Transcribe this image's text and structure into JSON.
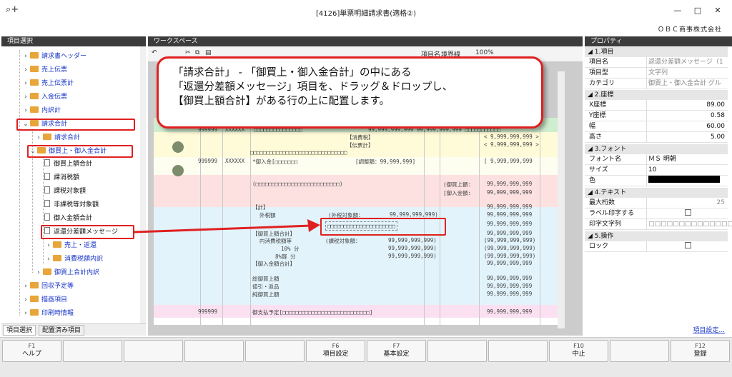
{
  "window": {
    "title": "[4126]単票明細請求書(適格②)",
    "company": "ＯＢＣ商事株式会社",
    "minimize": "—",
    "maximize": "□",
    "close": "✕"
  },
  "left_panel": {
    "header": "項目選択",
    "tree": [
      {
        "label": "請求書ヘッダー",
        "type": "folder",
        "expanded": false
      },
      {
        "label": "売上伝票",
        "type": "folder",
        "expanded": false
      },
      {
        "label": "売上伝票計",
        "type": "folder",
        "expanded": false
      },
      {
        "label": "入金伝票",
        "type": "folder",
        "expanded": false
      },
      {
        "label": "内訳計",
        "type": "folder",
        "expanded": false
      },
      {
        "label": "請求合計",
        "type": "folder",
        "expanded": true
      },
      {
        "label": "請求合計",
        "type": "folder",
        "expanded": false
      },
      {
        "label": "御買上・御入金合計",
        "type": "folder",
        "expanded": true
      },
      {
        "label": "御買上額合計",
        "type": "doc"
      },
      {
        "label": "課消税額",
        "type": "doc"
      },
      {
        "label": "課税対象額",
        "type": "doc"
      },
      {
        "label": "非課税等対象額",
        "type": "doc"
      },
      {
        "label": "御入金額合計",
        "type": "doc"
      },
      {
        "label": "返還分差額メッセージ",
        "type": "doc"
      },
      {
        "label": "売上・返還",
        "type": "folder",
        "expanded": false
      },
      {
        "label": "消費税額内訳",
        "type": "folder",
        "expanded": false
      },
      {
        "label": "御買上合計内訳",
        "type": "folder",
        "expanded": false
      },
      {
        "label": "回収予定等",
        "type": "folder",
        "expanded": false
      },
      {
        "label": "描画項目",
        "type": "folder",
        "expanded": false
      },
      {
        "label": "印刷時情報",
        "type": "folder",
        "expanded": false
      }
    ],
    "tabs": [
      "項目選択",
      "配置済み項目"
    ]
  },
  "workspace": {
    "header": "ワークスペース",
    "toolbar_labels": [
      "項目名",
      "境界線",
      "100%"
    ],
    "doc_texts": {
      "r1c1": "999999",
      "r1c2": "XXXXXX",
      "r1c3": "□□□□□□□□□□□□□□□",
      "r1c4": "99,999,999,999  99,999,999,999 □□□□□□□□□□□",
      "r2a": "【消費税】",
      "r2b": "< 9,999,999,999 >",
      "r3a": "【伝票計】",
      "r3b": "< 9,999,999,999 >",
      "r4": "□□□□□□□□□□□□□□□□□□□□□□□□□□□□□□",
      "r5a": "999999",
      "r5b": "XXXXXX",
      "r5c": "*御入金[□□□□□□□",
      "r5d": "[調整額：99,999,999]",
      "r5e": "[ 9,999,999,999",
      "r6a": "(□□□□□□□□□□□□□□□□□□□□□□□□□□)",
      "r6b": "(御買上額:",
      "r6c": "99,999,999,999",
      "r7a": "[御入金額:",
      "r7b": "99,999,999,999",
      "r8a": "【計】",
      "r8b": "99,999,999,999",
      "r9a": "外税額",
      "r9b": "(外税対象額：",
      "r9c": "99,999,999,999)",
      "r9d": "99,999,999,999",
      "r10a": "□□□□□□□□□□□□□□□□□□□□□",
      "r10b": "99,999,999,999",
      "r11a": "【御買上額合計】",
      "r11b": "99,999,999,999",
      "r12a": "内消費税額等",
      "r12b": "(課税対象額：",
      "r12c": "99,999,999,999)",
      "r12d": "(99,999,999,999)",
      "r13a": "10% 分",
      "r13b": "99,999,999,999)",
      "r13c": "(99,999,999,999)",
      "r14a": "8%軽 分",
      "r14b": "99,999,999,999)",
      "r14c": "(99,999,999,999)",
      "r15a": "【御入金額合計】",
      "r15b": "99,999,999,999",
      "r16a": "総御買上額",
      "r16b": "99,999,999,999",
      "r17a": "値引・返品",
      "r17b": "99,999,999,999",
      "r18a": "純御買上額",
      "r18b": "99,999,999,999",
      "r19a": "999999",
      "r19b": "御支払予定[□□□□□□□□□□□□□□□□□□□□□□□□□□□]",
      "r19c": "99,999,999,999"
    }
  },
  "callout": {
    "line1": "「請求合計」 - 「御買上・御入金合計」の中にある",
    "line2": "「返還分差額メッセージ」項目を、ドラッグ＆ドロップし、",
    "line3": "【御買上額合計】がある行の上に配置します。"
  },
  "right_panel": {
    "header": "プロパティ",
    "sections": {
      "item": "1.項目",
      "coord": "2.座標",
      "font": "3.フォント",
      "text": "4.テキスト",
      "op": "5.操作"
    },
    "props": {
      "name_k": "項目名",
      "name_v": "返還分差額メッセージ（1",
      "type_k": "項目型",
      "type_v": "文字列",
      "cat_k": "カテゴリ",
      "cat_v": "御買上・御入金合計 グル",
      "x_k": "X座標",
      "x_v": "89.00",
      "y_k": "Y座標",
      "y_v": "0.58",
      "w_k": "幅",
      "w_v": "60.00",
      "h_k": "高さ",
      "h_v": "5.00",
      "font_k": "フォント名",
      "font_v": "ＭＳ 明朝",
      "size_k": "サイズ",
      "size_v": "10",
      "color_k": "色",
      "digits_k": "最大桁数",
      "digits_v": "25",
      "label_k": "ラベル印字する",
      "print_k": "印字文字列",
      "print_v": "□□□□□□□□□□□□□□(",
      "lock_k": "ロック"
    },
    "item_settings": "項目設定..."
  },
  "fkeys": [
    {
      "n": "F1",
      "l": "ヘルプ"
    },
    {
      "n": "",
      "l": ""
    },
    {
      "n": "",
      "l": ""
    },
    {
      "n": "",
      "l": ""
    },
    {
      "n": "",
      "l": ""
    },
    {
      "n": "F6",
      "l": "項目設定"
    },
    {
      "n": "F7",
      "l": "基本設定"
    },
    {
      "n": "",
      "l": ""
    },
    {
      "n": "",
      "l": ""
    },
    {
      "n": "F10",
      "l": "中止"
    },
    {
      "n": "",
      "l": ""
    },
    {
      "n": "F12",
      "l": "登録"
    }
  ],
  "colors": {
    "highlight": "#e02020",
    "color_swatch": "#000000"
  }
}
